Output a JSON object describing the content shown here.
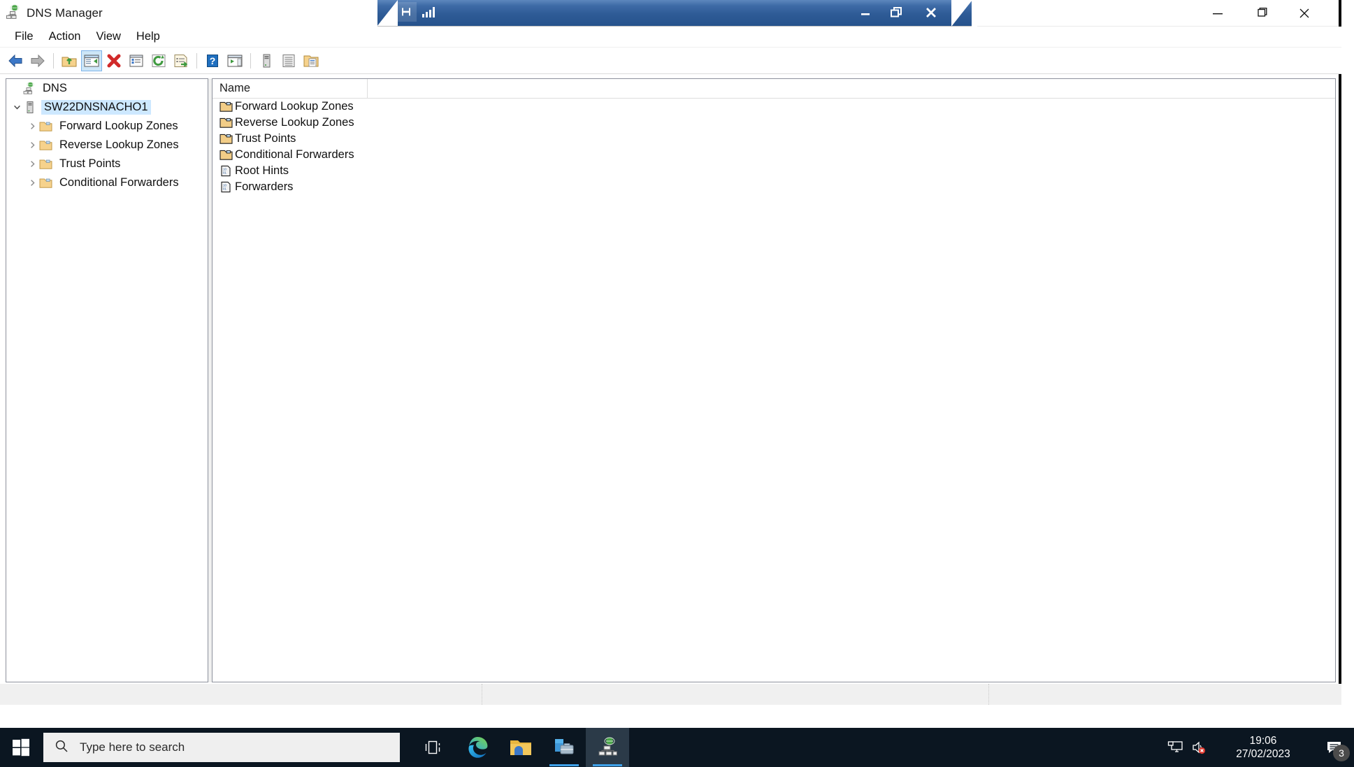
{
  "outer_window": {
    "controls": {
      "minimize": "minimize",
      "maximize": "restore",
      "close": "close"
    }
  },
  "rdp_bar": {
    "pin_icon": "pushpin-icon",
    "signal_icon": "connection-quality-icon",
    "title": "",
    "controls": {
      "minimize": "minimize",
      "restore": "restore",
      "close": "close"
    }
  },
  "app": {
    "title": "DNS Manager",
    "icon": "dns-server-icon",
    "menu": [
      {
        "label": "File"
      },
      {
        "label": "Action"
      },
      {
        "label": "View"
      },
      {
        "label": "Help"
      }
    ],
    "toolbar": [
      {
        "name": "back-button",
        "icon": "back-arrow-icon",
        "pressed": false
      },
      {
        "name": "forward-button",
        "icon": "forward-arrow-icon",
        "pressed": false
      },
      {
        "name": "separator-1",
        "icon": "separator",
        "pressed": false
      },
      {
        "name": "up-one-level-button",
        "icon": "up-folder-icon",
        "pressed": false
      },
      {
        "name": "show-hide-console-tree-button",
        "icon": "console-tree-icon",
        "pressed": true
      },
      {
        "name": "delete-button",
        "icon": "delete-x-icon",
        "pressed": false
      },
      {
        "name": "properties-button",
        "icon": "properties-icon",
        "pressed": false
      },
      {
        "name": "refresh-button",
        "icon": "refresh-icon",
        "pressed": false
      },
      {
        "name": "export-list-button",
        "icon": "export-list-icon",
        "pressed": false
      },
      {
        "name": "separator-2",
        "icon": "separator",
        "pressed": false
      },
      {
        "name": "help-button",
        "icon": "help-question-icon",
        "pressed": false
      },
      {
        "name": "show-action-pane-button",
        "icon": "action-pane-icon",
        "pressed": false
      },
      {
        "name": "separator-3",
        "icon": "separator",
        "pressed": false
      },
      {
        "name": "new-server-button",
        "icon": "server-tower-icon",
        "pressed": false
      },
      {
        "name": "event-log-button",
        "icon": "log-lines-icon",
        "pressed": false
      },
      {
        "name": "new-zone-button",
        "icon": "folder-document-icon",
        "pressed": false
      }
    ]
  },
  "tree": {
    "nodes": [
      {
        "label": "DNS",
        "icon": "dns-root-icon",
        "indent": 0,
        "chevron": "",
        "selected": false
      },
      {
        "label": "SW22DNSNACHO1",
        "icon": "server-tower-icon",
        "indent": 1,
        "chevron": "expanded",
        "selected": true
      },
      {
        "label": "Forward Lookup Zones",
        "icon": "folder-icon",
        "indent": 2,
        "chevron": "collapsed",
        "selected": false
      },
      {
        "label": "Reverse Lookup Zones",
        "icon": "folder-icon",
        "indent": 2,
        "chevron": "collapsed",
        "selected": false
      },
      {
        "label": "Trust Points",
        "icon": "folder-icon",
        "indent": 2,
        "chevron": "collapsed",
        "selected": false
      },
      {
        "label": "Conditional Forwarders",
        "icon": "folder-icon",
        "indent": 2,
        "chevron": "collapsed",
        "selected": false
      }
    ]
  },
  "list": {
    "columns": [
      {
        "label": "Name"
      }
    ],
    "rows": [
      {
        "name": "Forward Lookup Zones",
        "icon": "folder-icon"
      },
      {
        "name": "Reverse Lookup Zones",
        "icon": "folder-icon"
      },
      {
        "name": "Trust Points",
        "icon": "folder-icon"
      },
      {
        "name": "Conditional Forwarders",
        "icon": "folder-icon"
      },
      {
        "name": "Root Hints",
        "icon": "record-document-icon"
      },
      {
        "name": "Forwarders",
        "icon": "record-document-icon"
      }
    ]
  },
  "statusbar": {
    "cell_1": "",
    "cell_2": "",
    "cell_3": ""
  },
  "taskbar": {
    "start_icon": "windows-start-icon",
    "search": {
      "icon": "search-icon",
      "placeholder": "Type here to search",
      "value": ""
    },
    "apps": [
      {
        "name": "task-view-button",
        "icon": "task-view-icon",
        "running": false,
        "active": false
      },
      {
        "name": "taskbar-microsoft-edge",
        "icon": "edge-icon",
        "running": false,
        "active": false
      },
      {
        "name": "taskbar-file-explorer",
        "icon": "file-explorer-icon",
        "running": false,
        "active": false
      },
      {
        "name": "taskbar-server-manager",
        "icon": "server-manager-icon",
        "running": true,
        "active": false
      },
      {
        "name": "taskbar-dns-manager",
        "icon": "dns-server-icon",
        "running": true,
        "active": true
      }
    ],
    "tray": [
      {
        "name": "tray-remote-desktop",
        "icon": "remote-display-icon"
      },
      {
        "name": "tray-volume",
        "icon": "speaker-muted-icon"
      }
    ],
    "clock": {
      "time": "19:06",
      "date": "27/02/2023"
    },
    "action_center": {
      "icon": "notification-icon",
      "badge": "3"
    }
  },
  "colors": {
    "accent_blue": "#2e5b96",
    "selection_blue": "#cde8ff",
    "taskbar_bg": "#0b1621",
    "toolbar_pressed": "#cde6f7",
    "folder_yellow": "#f6d28c"
  }
}
